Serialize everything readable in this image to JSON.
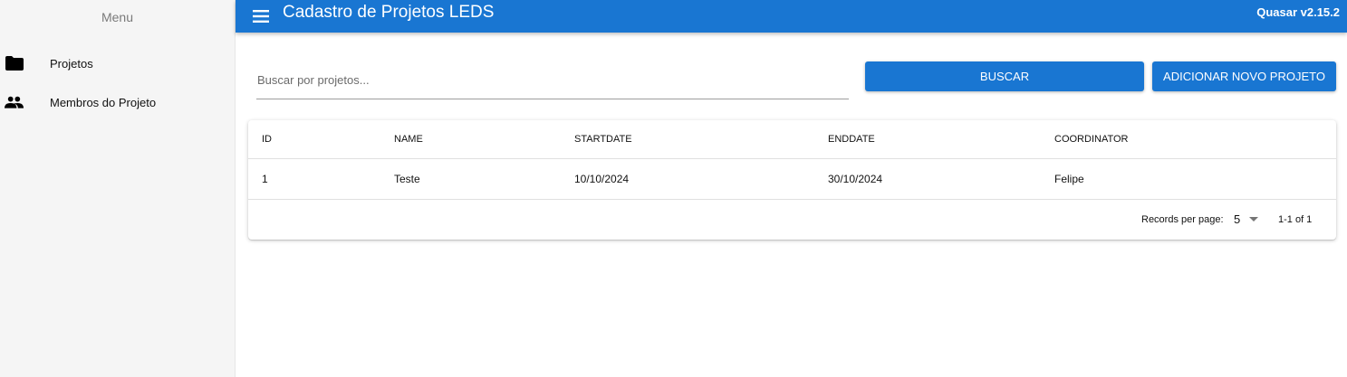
{
  "sidebar": {
    "title": "Menu",
    "items": [
      {
        "label": "Projetos",
        "icon": "folder-icon"
      },
      {
        "label": "Membros do Projeto",
        "icon": "people-icon"
      }
    ]
  },
  "header": {
    "title": "Cadastro de Projetos LEDS",
    "version": "Quasar v2.15.2",
    "background": "#1976d2"
  },
  "search": {
    "placeholder": "Buscar por projetos...",
    "value": ""
  },
  "buttons": {
    "search_label": "BUSCAR",
    "add_label": "ADICIONAR NOVO PROJETO"
  },
  "table": {
    "columns": [
      "ID",
      "NAME",
      "STARTDATE",
      "ENDDATE",
      "COORDINATOR"
    ],
    "rows": [
      [
        "1",
        "Teste",
        "10/10/2024",
        "30/10/2024",
        "Felipe"
      ]
    ],
    "footer": {
      "records_per_page_label": "Records per page:",
      "records_per_page": "5",
      "pagination_text": "1-1 of 1"
    }
  }
}
